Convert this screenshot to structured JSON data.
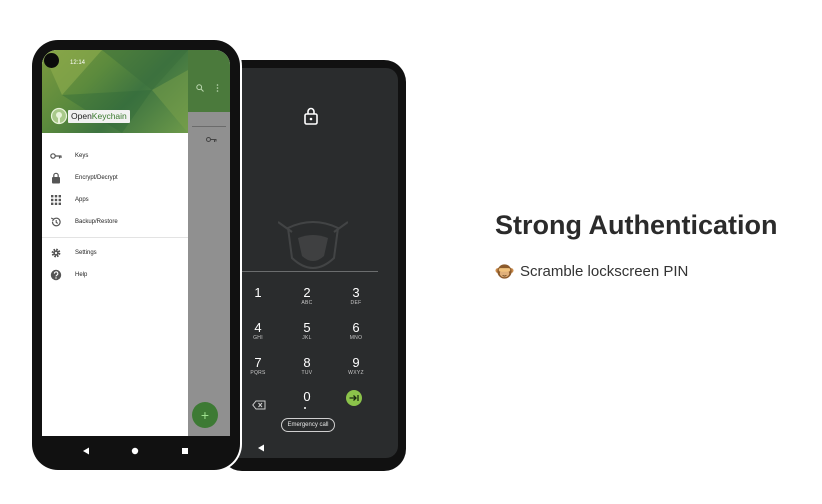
{
  "drawer": {
    "status_time": "12:14",
    "brand_open": "Open",
    "brand_keychain": "Keychain",
    "items": [
      {
        "label": "Keys",
        "icon": "key-icon"
      },
      {
        "label": "Encrypt/Decrypt",
        "icon": "lock-icon"
      },
      {
        "label": "Apps",
        "icon": "apps-grid-icon"
      },
      {
        "label": "Backup/Restore",
        "icon": "restore-icon"
      }
    ],
    "items2": [
      {
        "label": "Settings",
        "icon": "gear-icon"
      },
      {
        "label": "Help",
        "icon": "help-icon"
      }
    ],
    "fab_label": "+"
  },
  "lockscreen": {
    "keys": [
      {
        "num": "1",
        "sub": ""
      },
      {
        "num": "2",
        "sub": "ABC"
      },
      {
        "num": "3",
        "sub": "DEF"
      },
      {
        "num": "4",
        "sub": "GHI"
      },
      {
        "num": "5",
        "sub": "JKL"
      },
      {
        "num": "6",
        "sub": "MNO"
      },
      {
        "num": "7",
        "sub": "PQRS"
      },
      {
        "num": "8",
        "sub": "TUV"
      },
      {
        "num": "9",
        "sub": "WXYZ"
      },
      {
        "num": "0",
        "sub": ""
      }
    ],
    "emergency_label": "Emergency call"
  },
  "feature": {
    "title": "Strong Authentication",
    "subtitle": "Scramble lockscreen PIN",
    "emoji_icon": "monkey-icon"
  },
  "colors": {
    "accent_green": "#8bc34a",
    "header_green": "#4b7a3c",
    "lock_bg": "#2a2c2d"
  }
}
